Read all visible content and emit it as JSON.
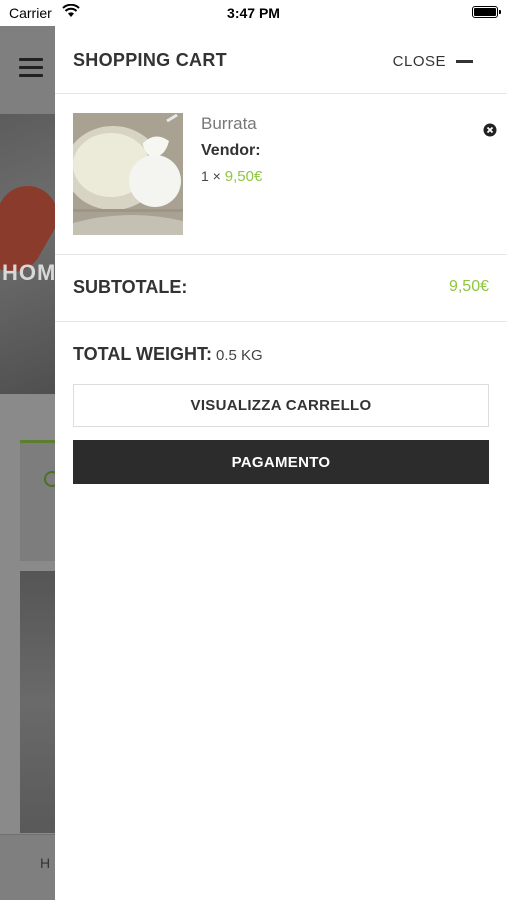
{
  "status_bar": {
    "carrier": "Carrier",
    "time": "3:47 PM"
  },
  "background": {
    "hero_text": "HOM",
    "footer_text": "H"
  },
  "drawer": {
    "title": "SHOPPING CART",
    "close_label": "CLOSE",
    "items": [
      {
        "name": "Burrata",
        "vendor_label": "Vendor:",
        "quantity": "1 ×",
        "price": "9,50€"
      }
    ],
    "subtotal_label": "SUBTOTALE:",
    "subtotal_value": "9,50€",
    "weight_label": "TOTAL WEIGHT:",
    "weight_value": "0.5 KG",
    "view_cart_label": "VISUALIZZA CARRELLO",
    "checkout_label": "PAGAMENTO"
  },
  "colors": {
    "accent_green": "#8dc63f",
    "checkout_bg": "#2c2c2c"
  },
  "icons": [
    "wifi-icon",
    "battery-icon",
    "menu-icon",
    "close-dash-icon",
    "remove-item-icon"
  ]
}
